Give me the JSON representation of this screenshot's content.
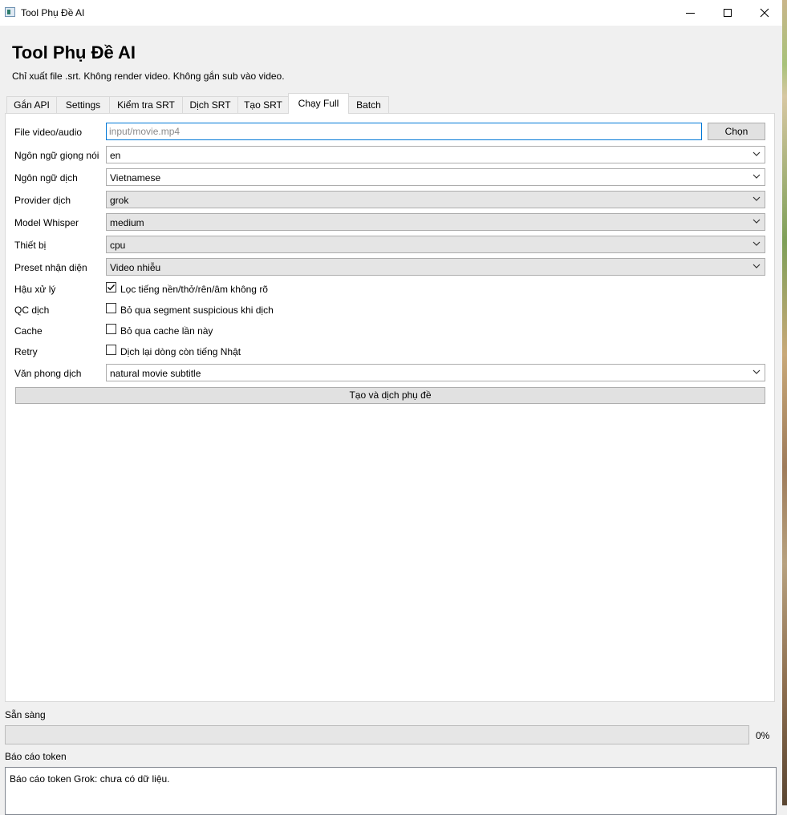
{
  "window": {
    "title": "Tool Phụ Đề AI",
    "controls": [
      "minimize-icon",
      "maximize-icon",
      "close-icon"
    ]
  },
  "header": {
    "title": "Tool Phụ Đề AI",
    "subtitle": "Chỉ xuất file .srt. Không render video. Không gắn sub vào video."
  },
  "tabs": [
    {
      "label": "Gắn API"
    },
    {
      "label": "Settings"
    },
    {
      "label": "Kiểm tra SRT"
    },
    {
      "label": "Dịch SRT"
    },
    {
      "label": "Tạo SRT"
    },
    {
      "label": "Chạy Full",
      "active": true
    },
    {
      "label": "Batch"
    }
  ],
  "form": {
    "file": {
      "label": "File video/audio",
      "value": "",
      "placeholder": "input/movie.mp4",
      "button": "Chọn"
    },
    "source_lang": {
      "label": "Ngôn ngữ giọng nói",
      "value": "en"
    },
    "target_lang": {
      "label": "Ngôn ngữ dịch",
      "value": "Vietnamese"
    },
    "provider": {
      "label": "Provider dịch",
      "value": "grok"
    },
    "model": {
      "label": "Model Whisper",
      "value": "medium"
    },
    "device": {
      "label": "Thiết bị",
      "value": "cpu"
    },
    "preset": {
      "label": "Preset nhận diện",
      "value": "Video nhiễu"
    },
    "postprocess": {
      "label": "Hậu xử lý",
      "text": "Lọc tiếng nền/thở/rên/âm không rõ",
      "checked": true
    },
    "qc": {
      "label": "QC dịch",
      "text": "Bỏ qua segment suspicious khi dịch",
      "checked": false
    },
    "cache": {
      "label": "Cache",
      "text": "Bỏ qua cache lần này",
      "checked": false
    },
    "retry": {
      "label": "Retry",
      "text": "Dịch lại dòng còn tiếng Nhật",
      "checked": false
    },
    "style": {
      "label": "Văn phong dịch",
      "value": "natural movie subtitle"
    },
    "run_button": "Tạo và dịch phụ đề"
  },
  "status": {
    "text": "Sẵn sàng",
    "progress": 0,
    "progress_label": "0%"
  },
  "report": {
    "label": "Báo cáo token",
    "text": "Báo cáo token Grok: chưa có dữ liệu."
  },
  "colors": {
    "focus_border": "#0078d7",
    "window_bg": "#f0f0f0",
    "panel_bg": "#ffffff"
  }
}
